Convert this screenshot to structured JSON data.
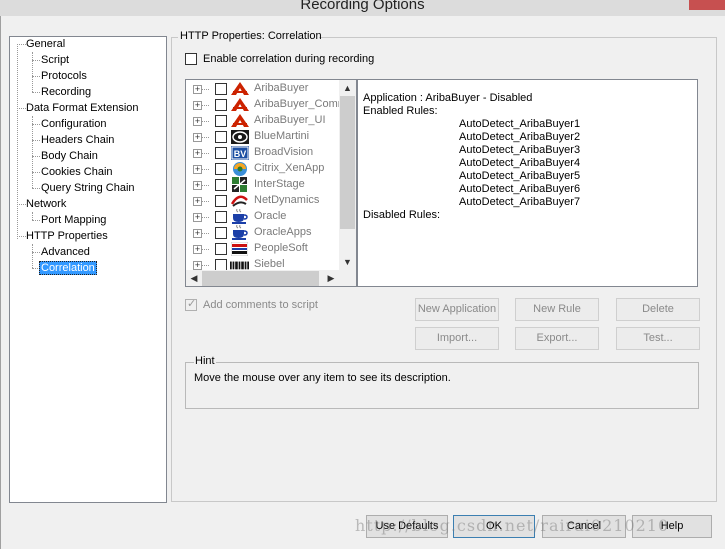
{
  "window": {
    "title": "Recording Options"
  },
  "tree": {
    "items": [
      {
        "label": "General"
      },
      {
        "label": "Script"
      },
      {
        "label": "Protocols"
      },
      {
        "label": "Recording"
      },
      {
        "label": "Data Format Extension"
      },
      {
        "label": "Configuration"
      },
      {
        "label": "Headers Chain"
      },
      {
        "label": "Body Chain"
      },
      {
        "label": "Cookies Chain"
      },
      {
        "label": "Query String Chain"
      },
      {
        "label": "Network"
      },
      {
        "label": "Port Mapping"
      },
      {
        "label": "HTTP Properties"
      },
      {
        "label": "Advanced"
      },
      {
        "label": "Correlation",
        "selected": true
      }
    ]
  },
  "panel": {
    "title": "HTTP Properties: Correlation",
    "enable_label": "Enable correlation during recording",
    "enable_checked": false,
    "add_comments_label": "Add comments to script",
    "add_comments_checked": true
  },
  "apps": [
    {
      "name": "AribaBuyer",
      "icon": "ariba-icon"
    },
    {
      "name": "AribaBuyer_Comm",
      "icon": "ariba-icon"
    },
    {
      "name": "AribaBuyer_UI",
      "icon": "ariba-icon"
    },
    {
      "name": "BlueMartini",
      "icon": "bluemartini-icon"
    },
    {
      "name": "BroadVision",
      "icon": "broadvision-icon"
    },
    {
      "name": "Citrix_XenApp",
      "icon": "citrix-icon"
    },
    {
      "name": "InterStage",
      "icon": "interstage-icon"
    },
    {
      "name": "NetDynamics",
      "icon": "netdynamics-icon"
    },
    {
      "name": "Oracle",
      "icon": "oracle-cup-icon"
    },
    {
      "name": "OracleApps",
      "icon": "oracle-cup-icon"
    },
    {
      "name": "PeopleSoft",
      "icon": "peoplesoft-icon"
    },
    {
      "name": "Siebel",
      "icon": "siebel-icon"
    }
  ],
  "details": {
    "application": "Application : AribaBuyer - Disabled",
    "enabled_rules_label": "Enabled Rules:",
    "enabled_rules": [
      "AutoDetect_AribaBuyer1",
      "AutoDetect_AribaBuyer2",
      "AutoDetect_AribaBuyer3",
      "AutoDetect_AribaBuyer4",
      "AutoDetect_AribaBuyer5",
      "AutoDetect_AribaBuyer6",
      "AutoDetect_AribaBuyer7"
    ],
    "disabled_rules_label": "Disabled Rules:"
  },
  "buttons": {
    "new_application": "New Application",
    "new_rule": "New Rule",
    "delete": "Delete",
    "import": "Import...",
    "export": "Export...",
    "test": "Test..."
  },
  "hint": {
    "title": "Hint",
    "text": "Move the mouse over any item to see its description."
  },
  "footer": {
    "use_defaults": "Use Defaults",
    "ok": "OK",
    "cancel": "Cancel",
    "help": "Help"
  },
  "watermark": "http://blog.csdn.net/rairai0210210",
  "colors": {
    "selection": "#3399ff",
    "ariba_red": "#cc2200",
    "broadvision_blue": "#1c4fa3"
  }
}
